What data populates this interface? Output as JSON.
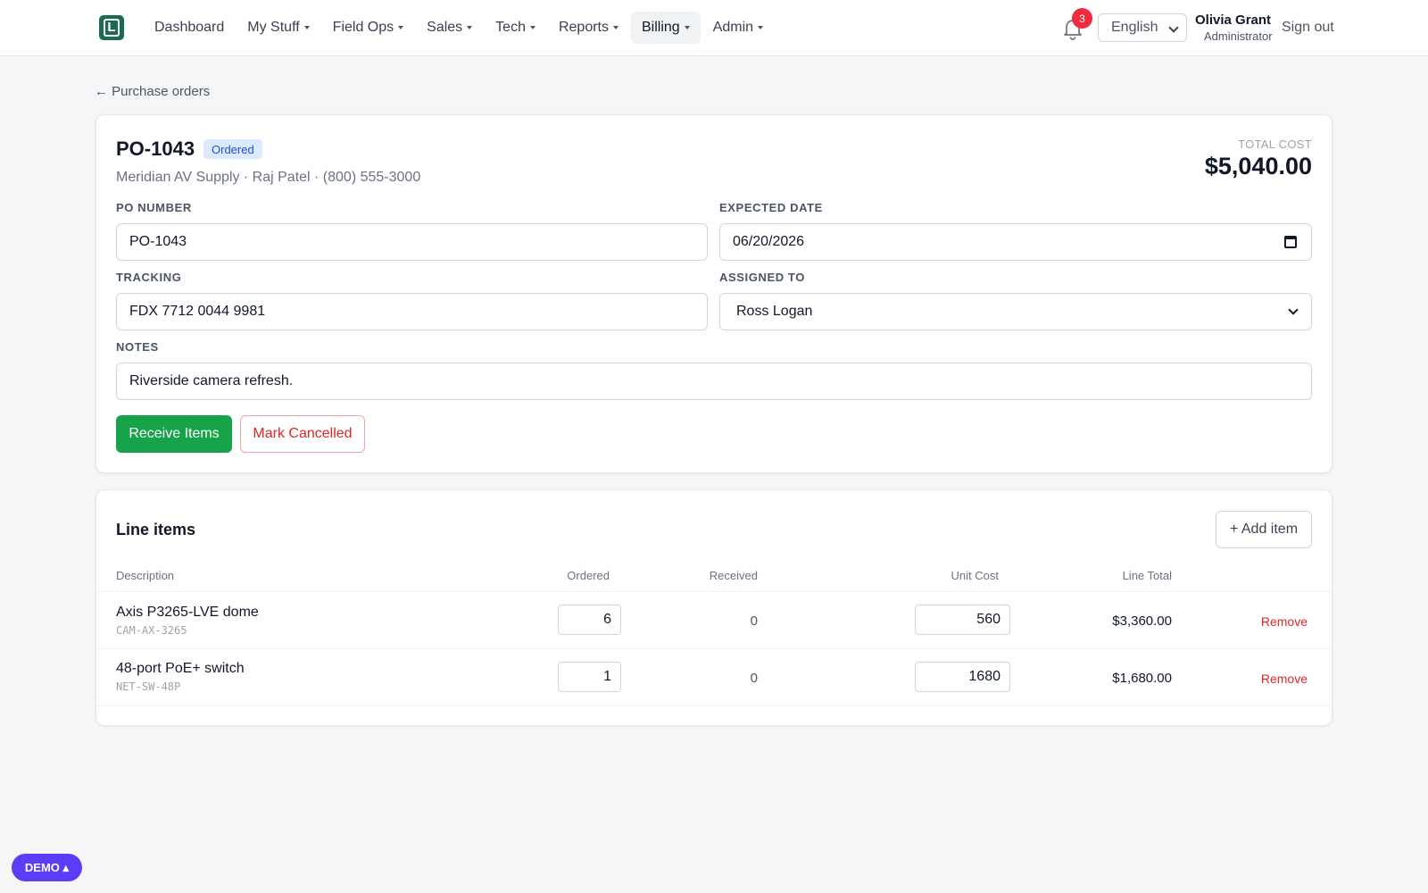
{
  "nav": {
    "logo_letter": "L",
    "items": [
      "Dashboard",
      "My Stuff",
      "Field Ops",
      "Sales",
      "Tech",
      "Reports",
      "Billing",
      "Admin"
    ],
    "active": "Billing",
    "notifications": "3",
    "language": "English",
    "user_name": "Olivia Grant",
    "user_role": "Administrator",
    "signout": "Sign out"
  },
  "back_link": "← Purchase orders",
  "po": {
    "title": "PO-1043",
    "status": "Ordered",
    "vendor_line": "Meridian AV Supply · Raj Patel · (800) 555-3000",
    "total_label": "TOTAL COST",
    "total_value": "$5,040.00",
    "fields": {
      "po_number_label": "PO NUMBER",
      "po_number": "PO-1043",
      "expected_label": "EXPECTED DATE",
      "expected": "06/20/2026",
      "tracking_label": "TRACKING",
      "tracking": "FDX 7712 0044 9981",
      "assigned_label": "ASSIGNED TO",
      "assigned": "Ross Logan",
      "notes_label": "NOTES",
      "notes": "Riverside camera refresh."
    },
    "receive_button": "Receive Items",
    "cancel_button": "Mark Cancelled"
  },
  "line_items": {
    "title": "Line items",
    "add_button": "+ Add item",
    "headers": {
      "description": "Description",
      "ordered": "Ordered",
      "received": "Received",
      "unit_cost": "Unit Cost",
      "line_total": "Line Total"
    },
    "rows": [
      {
        "description": "Axis P3265-LVE dome",
        "sku": "CAM-AX-3265",
        "ordered": "6",
        "received": "0",
        "unit_cost": "560",
        "line_total": "$3,360.00",
        "remove": "Remove"
      },
      {
        "description": "48-port PoE+ switch",
        "sku": "NET-SW-48P",
        "ordered": "1",
        "received": "0",
        "unit_cost": "1680",
        "line_total": "$1,680.00",
        "remove": "Remove"
      }
    ]
  },
  "demo_badge": "DEMO ▴",
  "colors": {
    "brand": "#1a6b4f",
    "accent_green": "#16a34a",
    "danger": "#dc2626",
    "badge_blue_bg": "#dbeafe",
    "demo_purple": "#5b3df5"
  }
}
